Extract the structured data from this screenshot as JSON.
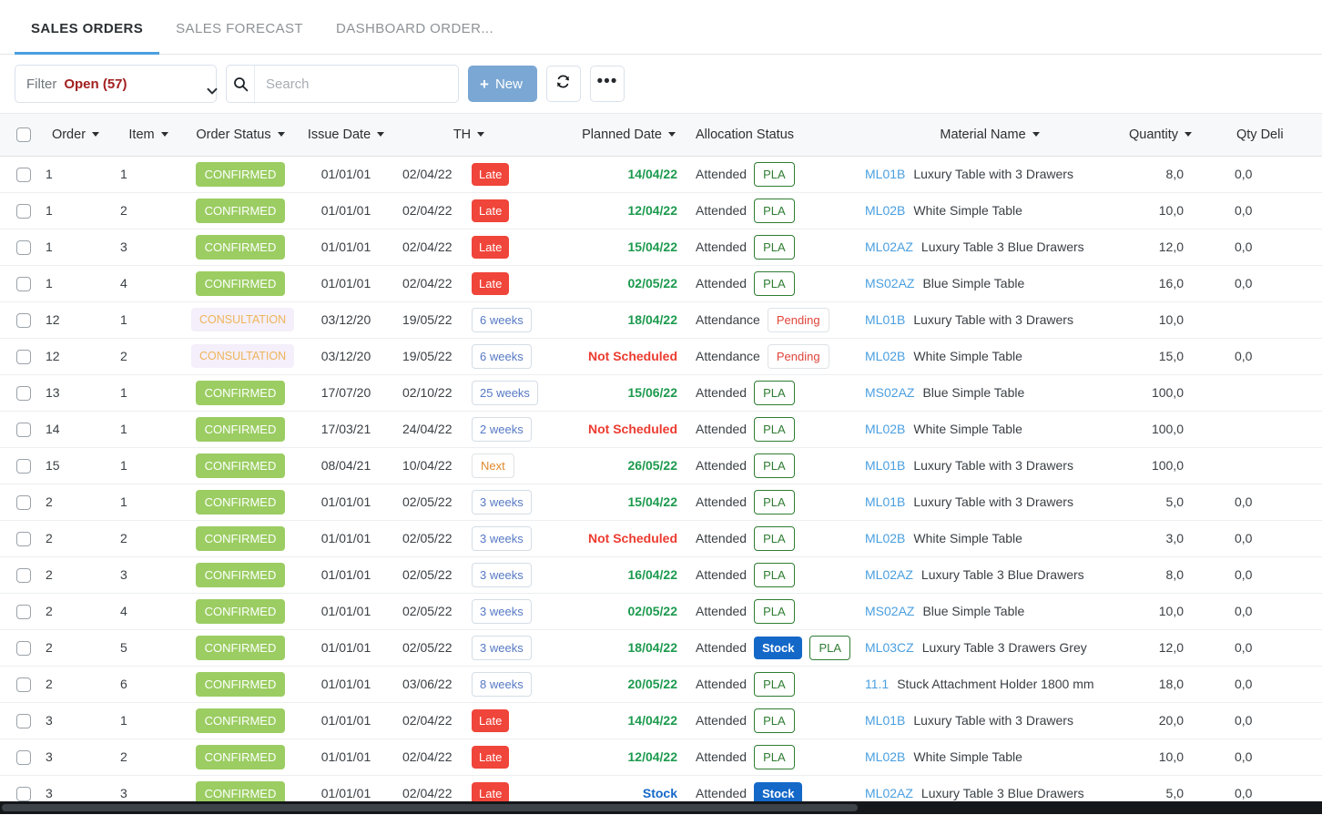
{
  "tabs": [
    {
      "label": "SALES ORDERS",
      "active": true
    },
    {
      "label": "SALES FORECAST",
      "active": false
    },
    {
      "label": "DASHBOARD ORDER...",
      "active": false
    }
  ],
  "toolbar": {
    "filter_label": "Filter",
    "filter_value": "Open (57)",
    "search_placeholder": "Search",
    "search_value": "",
    "new_label": "New",
    "plus_glyph": "+",
    "refresh_icon": "refresh-icon",
    "more_icon": "ellipsis-icon",
    "accent_color": "#7ba7d4"
  },
  "table": {
    "columns": [
      {
        "key": "checkbox",
        "label": "",
        "sortable": false
      },
      {
        "key": "order",
        "label": "Order",
        "sortable": true
      },
      {
        "key": "item",
        "label": "Item",
        "sortable": true
      },
      {
        "key": "order_status",
        "label": "Order Status",
        "sortable": true
      },
      {
        "key": "issue_date",
        "label": "Issue Date",
        "sortable": true
      },
      {
        "key": "th",
        "label": "TH",
        "sortable": true
      },
      {
        "key": "planned_date",
        "label": "Planned Date",
        "sortable": true
      },
      {
        "key": "allocation_status",
        "label": "Allocation Status",
        "sortable": false
      },
      {
        "key": "material_name",
        "label": "Material Name",
        "sortable": true
      },
      {
        "key": "quantity",
        "label": "Quantity",
        "sortable": true
      },
      {
        "key": "qty_delivered",
        "label": "Qty Deli",
        "sortable": false
      }
    ],
    "rows": [
      {
        "order": "1",
        "item": "1",
        "order_status": "CONFIRMED",
        "status_kind": "confirmed",
        "issue_date": "01/01/01",
        "th_date": "02/04/22",
        "th_badge": "Late",
        "th_kind": "late",
        "planned_date": "14/04/22",
        "planned_kind": "ok",
        "alloc_text": "Attended",
        "alloc_badges": [
          "PLA"
        ],
        "mat_code": "ML01B",
        "mat_desc": "Luxury Table with 3 Drawers",
        "quantity": "8,0",
        "qty_delivered": "0,0"
      },
      {
        "order": "1",
        "item": "2",
        "order_status": "CONFIRMED",
        "status_kind": "confirmed",
        "issue_date": "01/01/01",
        "th_date": "02/04/22",
        "th_badge": "Late",
        "th_kind": "late",
        "planned_date": "12/04/22",
        "planned_kind": "ok",
        "alloc_text": "Attended",
        "alloc_badges": [
          "PLA"
        ],
        "mat_code": "ML02B",
        "mat_desc": "White Simple Table",
        "quantity": "10,0",
        "qty_delivered": "0,0"
      },
      {
        "order": "1",
        "item": "3",
        "order_status": "CONFIRMED",
        "status_kind": "confirmed",
        "issue_date": "01/01/01",
        "th_date": "02/04/22",
        "th_badge": "Late",
        "th_kind": "late",
        "planned_date": "15/04/22",
        "planned_kind": "ok",
        "alloc_text": "Attended",
        "alloc_badges": [
          "PLA"
        ],
        "mat_code": "ML02AZ",
        "mat_desc": "Luxury Table 3 Blue Drawers",
        "quantity": "12,0",
        "qty_delivered": "0,0"
      },
      {
        "order": "1",
        "item": "4",
        "order_status": "CONFIRMED",
        "status_kind": "confirmed",
        "issue_date": "01/01/01",
        "th_date": "02/04/22",
        "th_badge": "Late",
        "th_kind": "late",
        "planned_date": "02/05/22",
        "planned_kind": "ok",
        "alloc_text": "Attended",
        "alloc_badges": [
          "PLA"
        ],
        "mat_code": "MS02AZ",
        "mat_desc": "Blue Simple Table",
        "quantity": "16,0",
        "qty_delivered": "0,0"
      },
      {
        "order": "12",
        "item": "1",
        "order_status": "CONSULTATION",
        "status_kind": "consultation",
        "issue_date": "03/12/20",
        "th_date": "19/05/22",
        "th_badge": "6 weeks",
        "th_kind": "weeks",
        "planned_date": "18/04/22",
        "planned_kind": "ok",
        "alloc_text": "Attendance",
        "alloc_badges": [
          "Pending"
        ],
        "mat_code": "ML01B",
        "mat_desc": "Luxury Table with 3 Drawers",
        "quantity": "10,0",
        "qty_delivered": ""
      },
      {
        "order": "12",
        "item": "2",
        "order_status": "CONSULTATION",
        "status_kind": "consultation",
        "issue_date": "03/12/20",
        "th_date": "19/05/22",
        "th_badge": "6 weeks",
        "th_kind": "weeks",
        "planned_date": "Not Scheduled",
        "planned_kind": "bad",
        "alloc_text": "Attendance",
        "alloc_badges": [
          "Pending"
        ],
        "mat_code": "ML02B",
        "mat_desc": "White Simple Table",
        "quantity": "15,0",
        "qty_delivered": "0,0"
      },
      {
        "order": "13",
        "item": "1",
        "order_status": "CONFIRMED",
        "status_kind": "confirmed",
        "issue_date": "17/07/20",
        "th_date": "02/10/22",
        "th_badge": "25 weeks",
        "th_kind": "weeks",
        "planned_date": "15/06/22",
        "planned_kind": "ok",
        "alloc_text": "Attended",
        "alloc_badges": [
          "PLA"
        ],
        "mat_code": "MS02AZ",
        "mat_desc": "Blue Simple Table",
        "quantity": "100,0",
        "qty_delivered": ""
      },
      {
        "order": "14",
        "item": "1",
        "order_status": "CONFIRMED",
        "status_kind": "confirmed",
        "issue_date": "17/03/21",
        "th_date": "24/04/22",
        "th_badge": "2 weeks",
        "th_kind": "weeks",
        "planned_date": "Not Scheduled",
        "planned_kind": "bad",
        "alloc_text": "Attended",
        "alloc_badges": [
          "PLA"
        ],
        "mat_code": "ML02B",
        "mat_desc": "White Simple Table",
        "quantity": "100,0",
        "qty_delivered": ""
      },
      {
        "order": "15",
        "item": "1",
        "order_status": "CONFIRMED",
        "status_kind": "confirmed",
        "issue_date": "08/04/21",
        "th_date": "10/04/22",
        "th_badge": "Next",
        "th_kind": "next",
        "planned_date": "26/05/22",
        "planned_kind": "ok",
        "alloc_text": "Attended",
        "alloc_badges": [
          "PLA"
        ],
        "mat_code": "ML01B",
        "mat_desc": "Luxury Table with 3 Drawers",
        "quantity": "100,0",
        "qty_delivered": ""
      },
      {
        "order": "2",
        "item": "1",
        "order_status": "CONFIRMED",
        "status_kind": "confirmed",
        "issue_date": "01/01/01",
        "th_date": "02/05/22",
        "th_badge": "3 weeks",
        "th_kind": "weeks",
        "planned_date": "15/04/22",
        "planned_kind": "ok",
        "alloc_text": "Attended",
        "alloc_badges": [
          "PLA"
        ],
        "mat_code": "ML01B",
        "mat_desc": "Luxury Table with 3 Drawers",
        "quantity": "5,0",
        "qty_delivered": "0,0"
      },
      {
        "order": "2",
        "item": "2",
        "order_status": "CONFIRMED",
        "status_kind": "confirmed",
        "issue_date": "01/01/01",
        "th_date": "02/05/22",
        "th_badge": "3 weeks",
        "th_kind": "weeks",
        "planned_date": "Not Scheduled",
        "planned_kind": "bad",
        "alloc_text": "Attended",
        "alloc_badges": [
          "PLA"
        ],
        "mat_code": "ML02B",
        "mat_desc": "White Simple Table",
        "quantity": "3,0",
        "qty_delivered": "0,0"
      },
      {
        "order": "2",
        "item": "3",
        "order_status": "CONFIRMED",
        "status_kind": "confirmed",
        "issue_date": "01/01/01",
        "th_date": "02/05/22",
        "th_badge": "3 weeks",
        "th_kind": "weeks",
        "planned_date": "16/04/22",
        "planned_kind": "ok",
        "alloc_text": "Attended",
        "alloc_badges": [
          "PLA"
        ],
        "mat_code": "ML02AZ",
        "mat_desc": "Luxury Table 3 Blue Drawers",
        "quantity": "8,0",
        "qty_delivered": "0,0"
      },
      {
        "order": "2",
        "item": "4",
        "order_status": "CONFIRMED",
        "status_kind": "confirmed",
        "issue_date": "01/01/01",
        "th_date": "02/05/22",
        "th_badge": "3 weeks",
        "th_kind": "weeks",
        "planned_date": "02/05/22",
        "planned_kind": "ok",
        "alloc_text": "Attended",
        "alloc_badges": [
          "PLA"
        ],
        "mat_code": "MS02AZ",
        "mat_desc": "Blue Simple Table",
        "quantity": "10,0",
        "qty_delivered": "0,0"
      },
      {
        "order": "2",
        "item": "5",
        "order_status": "CONFIRMED",
        "status_kind": "confirmed",
        "issue_date": "01/01/01",
        "th_date": "02/05/22",
        "th_badge": "3 weeks",
        "th_kind": "weeks",
        "planned_date": "18/04/22",
        "planned_kind": "ok",
        "alloc_text": "Attended",
        "alloc_badges": [
          "Stock",
          "PLA"
        ],
        "mat_code": "ML03CZ",
        "mat_desc": "Luxury Table 3 Drawers Grey",
        "quantity": "12,0",
        "qty_delivered": "0,0"
      },
      {
        "order": "2",
        "item": "6",
        "order_status": "CONFIRMED",
        "status_kind": "confirmed",
        "issue_date": "01/01/01",
        "th_date": "03/06/22",
        "th_badge": "8 weeks",
        "th_kind": "weeks",
        "planned_date": "20/05/22",
        "planned_kind": "ok",
        "alloc_text": "Attended",
        "alloc_badges": [
          "PLA"
        ],
        "mat_code": "11.1",
        "mat_desc": "Stuck Attachment Holder 1800 mm",
        "quantity": "18,0",
        "qty_delivered": "0,0"
      },
      {
        "order": "3",
        "item": "1",
        "order_status": "CONFIRMED",
        "status_kind": "confirmed",
        "issue_date": "01/01/01",
        "th_date": "02/04/22",
        "th_badge": "Late",
        "th_kind": "late",
        "planned_date": "14/04/22",
        "planned_kind": "ok",
        "alloc_text": "Attended",
        "alloc_badges": [
          "PLA"
        ],
        "mat_code": "ML01B",
        "mat_desc": "Luxury Table with 3 Drawers",
        "quantity": "20,0",
        "qty_delivered": "0,0"
      },
      {
        "order": "3",
        "item": "2",
        "order_status": "CONFIRMED",
        "status_kind": "confirmed",
        "issue_date": "01/01/01",
        "th_date": "02/04/22",
        "th_badge": "Late",
        "th_kind": "late",
        "planned_date": "12/04/22",
        "planned_kind": "ok",
        "alloc_text": "Attended",
        "alloc_badges": [
          "PLA"
        ],
        "mat_code": "ML02B",
        "mat_desc": "White Simple Table",
        "quantity": "10,0",
        "qty_delivered": "0,0"
      },
      {
        "order": "3",
        "item": "3",
        "order_status": "CONFIRMED",
        "status_kind": "confirmed",
        "issue_date": "01/01/01",
        "th_date": "02/04/22",
        "th_badge": "Late",
        "th_kind": "late",
        "planned_date": "Stock",
        "planned_kind": "stock",
        "alloc_text": "Attended",
        "alloc_badges": [
          "Stock"
        ],
        "mat_code": "ML02AZ",
        "mat_desc": "Luxury Table 3 Blue Drawers",
        "quantity": "5,0",
        "qty_delivered": "0,0"
      }
    ]
  },
  "colors": {
    "confirmed": "#9bcd62",
    "consultation_text": "#efb45a",
    "late": "#f0453a",
    "stock": "#1468c8",
    "pla": "#2f7d32",
    "pending": "#e0443a",
    "date_ok": "#1d9a4e",
    "date_bad": "#ec3b30",
    "link": "#4a9fe0"
  }
}
